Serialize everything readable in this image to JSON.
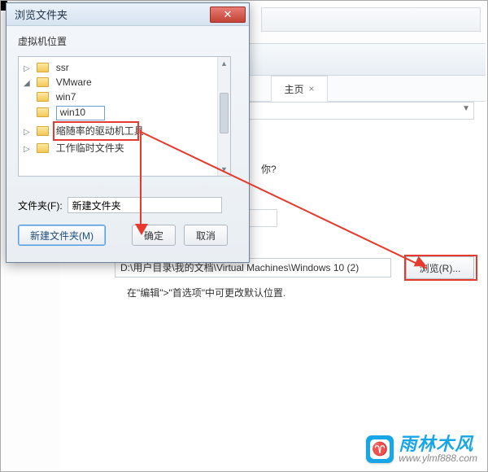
{
  "dialog": {
    "title": "浏览文件夹",
    "subtitle": "虚拟机位置",
    "tree": {
      "items": [
        {
          "label": "ssr",
          "toggle": "▷",
          "depth": 1
        },
        {
          "label": "VMware",
          "toggle": "◢",
          "depth": 1
        },
        {
          "label": "win7",
          "toggle": "",
          "depth": 2
        },
        {
          "label": "win10",
          "toggle": "",
          "depth": 2,
          "editing": true
        },
        {
          "label": "缩随率的驱动机工具",
          "toggle": "▷",
          "depth": 1
        },
        {
          "label": "工作临时文件夹",
          "toggle": "▷",
          "depth": 1
        }
      ]
    },
    "folder_label": "文件夹(F):",
    "folder_value": "新建文件夹",
    "new_folder_btn": "新建文件夹(M)",
    "ok_btn": "确定",
    "cancel_btn": "取消",
    "close_glyph": "✕"
  },
  "background": {
    "tab_label": "主页",
    "tab_close": "×",
    "question_suffix": "你?",
    "path_value": "D:\\用户目录\\我的文档\\Virtual Machines\\Windows 10 (2)",
    "browse_btn": "浏览(R)...",
    "hint": "在\"编辑\">\"首选项\"中可更改默认位置."
  },
  "logo": {
    "glyph": "♈",
    "cn": "雨林木风",
    "url": "www.ylmf888.com"
  }
}
